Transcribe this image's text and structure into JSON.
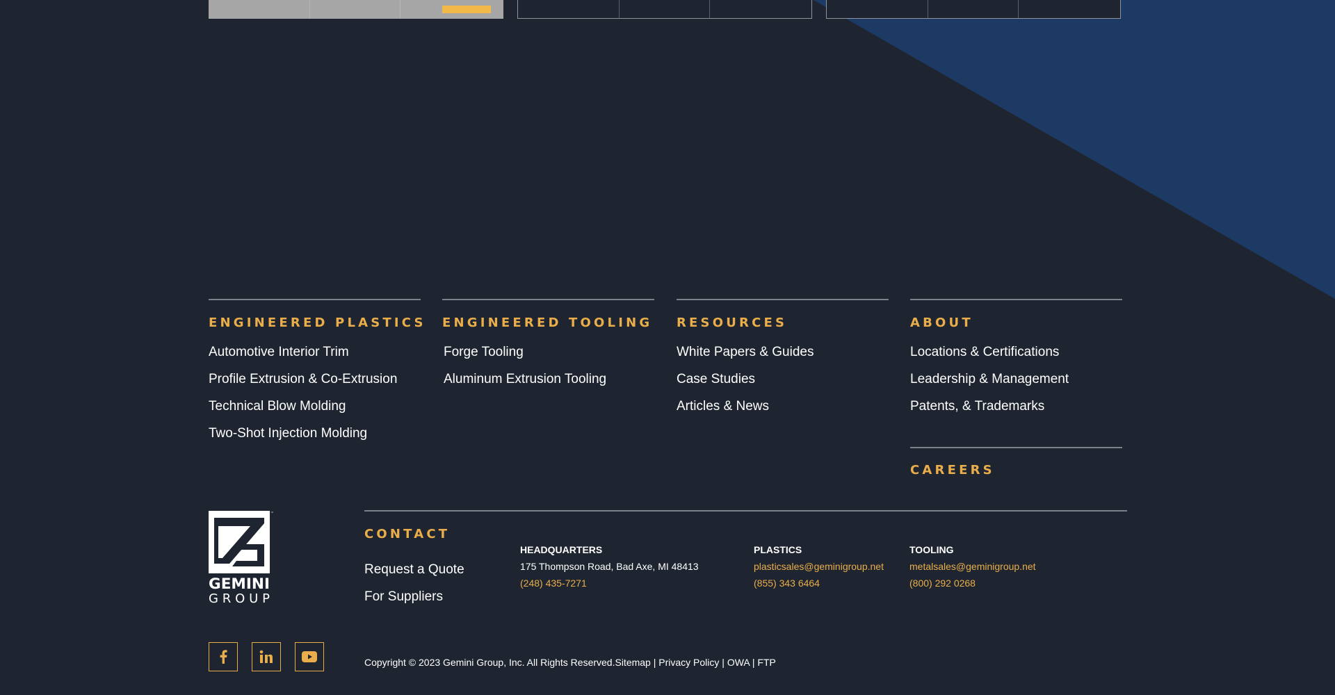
{
  "top_cards": [
    {
      "style": "filled",
      "button_color": "#f1b84a"
    },
    {
      "style": "outline"
    },
    {
      "style": "outline"
    }
  ],
  "colors": {
    "background": "#1f2530",
    "stripe": "#1d3a64",
    "accent": "#e9ae4b",
    "text": "#ffffff",
    "rule": "#7b808a"
  },
  "columns": [
    {
      "title": "ENGINEERED PLASTICS",
      "links": [
        "Automotive Interior Trim",
        "Profile Extrusion & Co-Extrusion",
        "Technical Blow Molding",
        "Two-Shot Injection Molding"
      ]
    },
    {
      "title": "ENGINEERED TOOLING",
      "links": [
        "Forge Tooling",
        "Aluminum Extrusion Tooling"
      ]
    },
    {
      "title": "RESOURCES",
      "links": [
        "White Papers & Guides",
        "Case Studies",
        "Articles & News"
      ]
    },
    {
      "title": "ABOUT",
      "links": [
        "Locations & Certifications",
        "Leadership & Management",
        "Patents, & Trademarks"
      ]
    }
  ],
  "careers": {
    "title": "CAREERS"
  },
  "logo": {
    "name": "GEMINI",
    "sub": "GROUP",
    "tm": "™"
  },
  "contact": {
    "title": "CONTACT",
    "links": [
      "Request a Quote",
      "For Suppliers"
    ]
  },
  "addresses": {
    "hq": {
      "heading": "HEADQUARTERS",
      "address": "175 Thompson Road, Bad Axe, MI 48413",
      "phone": "(248) 435-7271"
    },
    "plastics": {
      "heading": "PLASTICS",
      "email": "plasticsales@geminigroup.net",
      "phone": "(855) 343 6464"
    },
    "tooling": {
      "heading": "TOOLING",
      "email": "metalsales@geminigroup.net",
      "phone": "(800) 292 0268"
    }
  },
  "social": [
    {
      "icon": "facebook-icon"
    },
    {
      "icon": "linkedin-icon"
    },
    {
      "icon": "youtube-icon"
    }
  ],
  "legal": {
    "copyright": "Copyright © 2023 Gemini Group, Inc. All Rights Reserved.",
    "sitemap": "Sitemap",
    "sep": " | ",
    "privacy": "Privacy Policy",
    "owa": "OWA",
    "ftp": "FTP"
  }
}
